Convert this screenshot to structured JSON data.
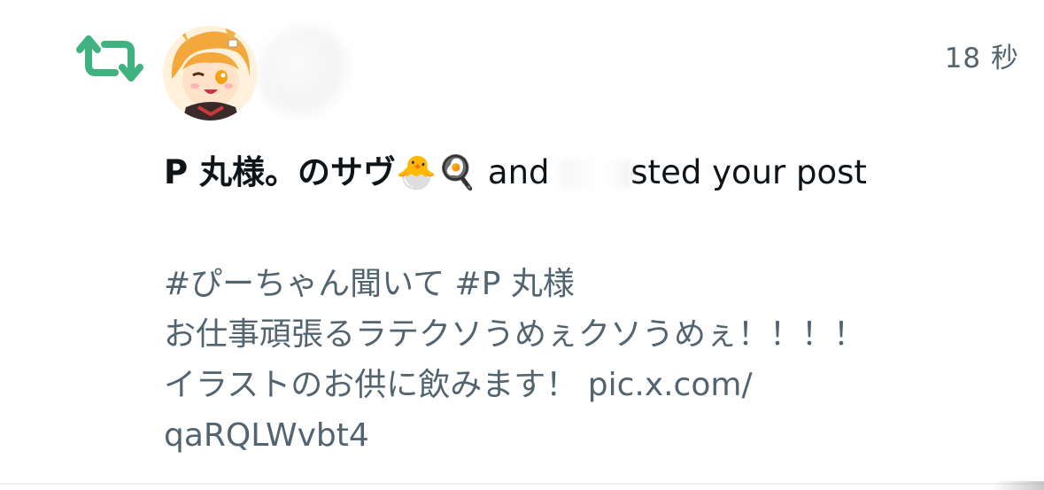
{
  "notification": {
    "type_icon": "retweet-icon",
    "accent_color": "#00ba7c",
    "timestamp": "18 秒",
    "actor_name": "P 丸様。のサヴ🐣🍳",
    "connector": " and ",
    "action_text": "sted your post",
    "post": {
      "hashtags": "#ぴーちゃん聞いて  #P 丸様",
      "line1": "お仕事頑張るラテクソうめぇクソうめぇ！！！！",
      "line2": "イラストのお供に飲みます！ pic.x.com/",
      "line3": "qaRQLWvbt4"
    }
  }
}
